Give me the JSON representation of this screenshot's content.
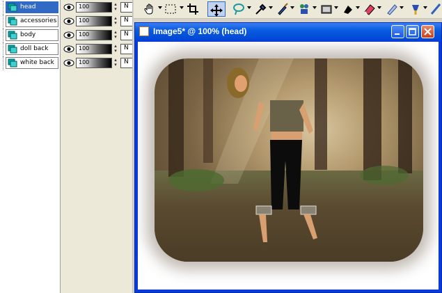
{
  "layers": [
    {
      "name": "head",
      "opacity": "100",
      "blend": "N",
      "selected": true
    },
    {
      "name": "accessories",
      "opacity": "100",
      "blend": "N",
      "selected": false
    },
    {
      "name": "body",
      "opacity": "100",
      "blend": "N",
      "selected": false
    },
    {
      "name": "doll back",
      "opacity": "100",
      "blend": "N",
      "selected": false
    },
    {
      "name": "white back",
      "opacity": "100",
      "blend": "N",
      "selected": false
    }
  ],
  "toolbar": {
    "tools": [
      "pan-icon",
      "selection-icon",
      "crop-icon",
      "move-icon",
      "freehand-selection-icon",
      "dropper-icon",
      "paint-brush-icon",
      "clone-brush-icon",
      "picture-tube-icon",
      "fill-icon",
      "eraser-icon",
      "smudge-icon",
      "retouch-icon",
      "text-icon"
    ]
  },
  "window": {
    "title": "Image5* @ 100% (head)",
    "accent": "#0a3ad8"
  },
  "colors": {
    "selection": "#316ac5",
    "titlebar": "#0046d5"
  }
}
